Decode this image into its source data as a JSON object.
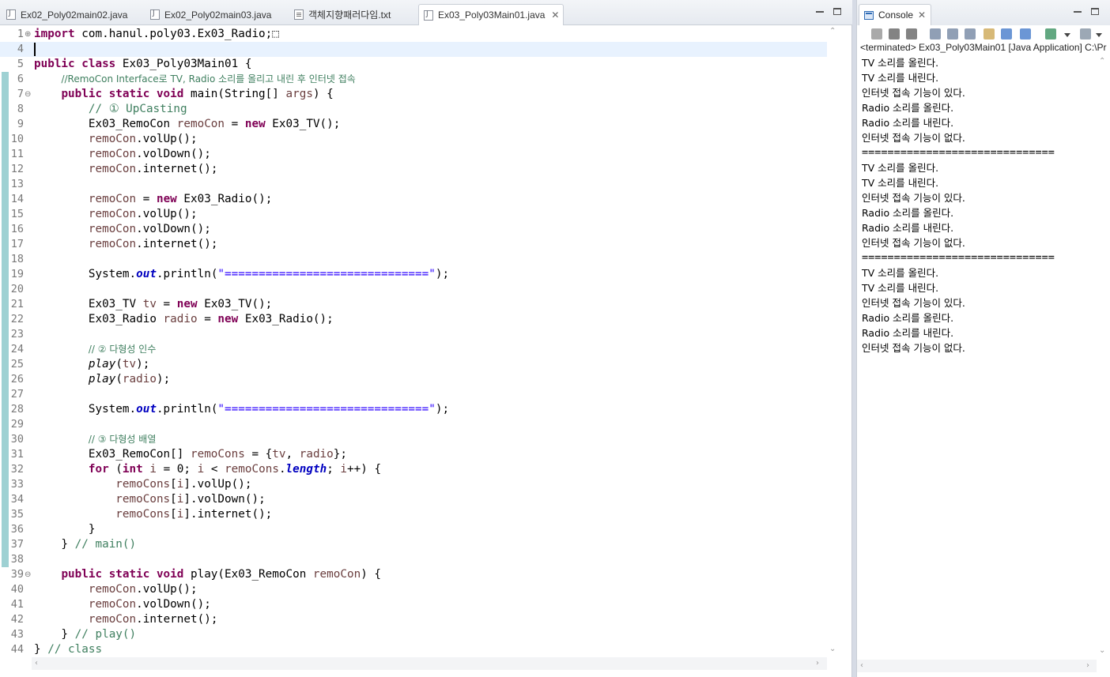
{
  "editor": {
    "tabs": [
      {
        "label": "Ex02_Poly02main02.java",
        "icon": "java-file-icon"
      },
      {
        "label": "Ex02_Poly02main03.java",
        "icon": "java-file-icon"
      },
      {
        "label": "객체지향패러다임.txt",
        "icon": "text-file-icon"
      },
      {
        "label": "Ex03_Poly03Main01.java",
        "icon": "java-file-icon",
        "active": true
      }
    ],
    "close_glyph": "✕",
    "lines": [
      {
        "n": "1",
        "fold": "⊕",
        "seg": [
          [
            "kw",
            "import"
          ],
          [
            "",
            "com.hanul.poly03.Ex03_Radio;"
          ],
          [
            "",
            "⬚"
          ]
        ]
      },
      {
        "n": "4",
        "cur": true,
        "seg": []
      },
      {
        "n": "5",
        "seg": [
          [
            "kw",
            "public class"
          ],
          [
            "",
            " Ex03_Poly03Main01 {"
          ]
        ]
      },
      {
        "n": "6",
        "seg": [
          [
            "",
            "    "
          ],
          [
            "cm",
            "//RemoCon Interface로 TV, Radio 소리를 올리고 내린 후 인터넷 접속"
          ]
        ]
      },
      {
        "n": "7",
        "fold": "⊖",
        "seg": [
          [
            "",
            "    "
          ],
          [
            "kw",
            "public static void"
          ],
          [
            "",
            " main(String[] "
          ],
          [
            "vr",
            "args"
          ],
          [
            "",
            ") {"
          ]
        ]
      },
      {
        "n": "8",
        "seg": [
          [
            "",
            "        "
          ],
          [
            "cm",
            "// ① UpCasting"
          ]
        ]
      },
      {
        "n": "9",
        "seg": [
          [
            "",
            "        Ex03_RemoCon "
          ],
          [
            "vr",
            "remoCon"
          ],
          [
            "",
            " = "
          ],
          [
            "kw",
            "new"
          ],
          [
            "",
            " Ex03_TV();"
          ]
        ]
      },
      {
        "n": "10",
        "seg": [
          [
            "",
            "        "
          ],
          [
            "vr",
            "remoCon"
          ],
          [
            "",
            ".volUp();"
          ]
        ]
      },
      {
        "n": "11",
        "seg": [
          [
            "",
            "        "
          ],
          [
            "vr",
            "remoCon"
          ],
          [
            "",
            ".volDown();"
          ]
        ]
      },
      {
        "n": "12",
        "seg": [
          [
            "",
            "        "
          ],
          [
            "vr",
            "remoCon"
          ],
          [
            "",
            ".internet();"
          ]
        ]
      },
      {
        "n": "13",
        "seg": []
      },
      {
        "n": "14",
        "seg": [
          [
            "",
            "        "
          ],
          [
            "vr",
            "remoCon"
          ],
          [
            "",
            " = "
          ],
          [
            "kw",
            "new"
          ],
          [
            "",
            " Ex03_Radio();"
          ]
        ]
      },
      {
        "n": "15",
        "seg": [
          [
            "",
            "        "
          ],
          [
            "vr",
            "remoCon"
          ],
          [
            "",
            ".volUp();"
          ]
        ]
      },
      {
        "n": "16",
        "seg": [
          [
            "",
            "        "
          ],
          [
            "vr",
            "remoCon"
          ],
          [
            "",
            ".volDown();"
          ]
        ]
      },
      {
        "n": "17",
        "seg": [
          [
            "",
            "        "
          ],
          [
            "vr",
            "remoCon"
          ],
          [
            "",
            ".internet();"
          ]
        ]
      },
      {
        "n": "18",
        "seg": []
      },
      {
        "n": "19",
        "seg": [
          [
            "",
            "        System."
          ],
          [
            "fld",
            "out"
          ],
          [
            "",
            ".println("
          ],
          [
            "st",
            "\"==============================\""
          ],
          [
            "",
            ");"
          ]
        ]
      },
      {
        "n": "20",
        "seg": []
      },
      {
        "n": "21",
        "seg": [
          [
            "",
            "        Ex03_TV "
          ],
          [
            "vr",
            "tv"
          ],
          [
            "",
            " = "
          ],
          [
            "kw",
            "new"
          ],
          [
            "",
            " Ex03_TV();"
          ]
        ]
      },
      {
        "n": "22",
        "seg": [
          [
            "",
            "        Ex03_Radio "
          ],
          [
            "vr",
            "radio"
          ],
          [
            "",
            " = "
          ],
          [
            "kw",
            "new"
          ],
          [
            "",
            " Ex03_Radio();"
          ]
        ]
      },
      {
        "n": "23",
        "seg": []
      },
      {
        "n": "24",
        "seg": [
          [
            "",
            "        "
          ],
          [
            "cm",
            "// ② 다형성 인수"
          ]
        ]
      },
      {
        "n": "25",
        "seg": [
          [
            "",
            "        "
          ],
          [
            "sm",
            "play"
          ],
          [
            "",
            "("
          ],
          [
            "vr",
            "tv"
          ],
          [
            "",
            ");"
          ]
        ]
      },
      {
        "n": "26",
        "seg": [
          [
            "",
            "        "
          ],
          [
            "sm",
            "play"
          ],
          [
            "",
            "("
          ],
          [
            "vr",
            "radio"
          ],
          [
            "",
            ");"
          ]
        ]
      },
      {
        "n": "27",
        "seg": []
      },
      {
        "n": "28",
        "seg": [
          [
            "",
            "        System."
          ],
          [
            "fld",
            "out"
          ],
          [
            "",
            ".println("
          ],
          [
            "st",
            "\"==============================\""
          ],
          [
            "",
            ");"
          ]
        ]
      },
      {
        "n": "29",
        "seg": []
      },
      {
        "n": "30",
        "seg": [
          [
            "",
            "        "
          ],
          [
            "cm",
            "// ③ 다형성 배열"
          ]
        ]
      },
      {
        "n": "31",
        "seg": [
          [
            "",
            "        Ex03_RemoCon[] "
          ],
          [
            "vr",
            "remoCons"
          ],
          [
            "",
            " = {"
          ],
          [
            "vr",
            "tv"
          ],
          [
            "",
            ", "
          ],
          [
            "vr",
            "radio"
          ],
          [
            "",
            "};"
          ]
        ]
      },
      {
        "n": "32",
        "seg": [
          [
            "",
            "        "
          ],
          [
            "kw",
            "for"
          ],
          [
            "",
            " ("
          ],
          [
            "kw",
            "int"
          ],
          [
            "",
            " "
          ],
          [
            "vr",
            "i"
          ],
          [
            "",
            " = 0; "
          ],
          [
            "vr",
            "i"
          ],
          [
            "",
            " < "
          ],
          [
            "vr",
            "remoCons"
          ],
          [
            "",
            "."
          ],
          [
            "fld",
            "length"
          ],
          [
            "",
            "; "
          ],
          [
            "vr",
            "i"
          ],
          [
            "",
            "++) {"
          ]
        ]
      },
      {
        "n": "33",
        "seg": [
          [
            "",
            "            "
          ],
          [
            "vr",
            "remoCons"
          ],
          [
            "",
            "["
          ],
          [
            "vr",
            "i"
          ],
          [
            "",
            "].volUp();"
          ]
        ]
      },
      {
        "n": "34",
        "seg": [
          [
            "",
            "            "
          ],
          [
            "vr",
            "remoCons"
          ],
          [
            "",
            "["
          ],
          [
            "vr",
            "i"
          ],
          [
            "",
            "].volDown();"
          ]
        ]
      },
      {
        "n": "35",
        "seg": [
          [
            "",
            "            "
          ],
          [
            "vr",
            "remoCons"
          ],
          [
            "",
            "["
          ],
          [
            "vr",
            "i"
          ],
          [
            "",
            "].internet();"
          ]
        ]
      },
      {
        "n": "36",
        "seg": [
          [
            "",
            "        }"
          ]
        ]
      },
      {
        "n": "37",
        "seg": [
          [
            "",
            "    } "
          ],
          [
            "cm",
            "// main()"
          ]
        ]
      },
      {
        "n": "38",
        "seg": []
      },
      {
        "n": "39",
        "fold": "⊖",
        "seg": [
          [
            "",
            "    "
          ],
          [
            "kw",
            "public static void"
          ],
          [
            "",
            " play(Ex03_RemoCon "
          ],
          [
            "vr",
            "remoCon"
          ],
          [
            "",
            ") {"
          ]
        ]
      },
      {
        "n": "40",
        "seg": [
          [
            "",
            "        "
          ],
          [
            "vr",
            "remoCon"
          ],
          [
            "",
            ".volUp();"
          ]
        ]
      },
      {
        "n": "41",
        "seg": [
          [
            "",
            "        "
          ],
          [
            "vr",
            "remoCon"
          ],
          [
            "",
            ".volDown();"
          ]
        ]
      },
      {
        "n": "42",
        "seg": [
          [
            "",
            "        "
          ],
          [
            "vr",
            "remoCon"
          ],
          [
            "",
            ".internet();"
          ]
        ]
      },
      {
        "n": "43",
        "seg": [
          [
            "",
            "    } "
          ],
          [
            "cm",
            "// play()"
          ]
        ]
      },
      {
        "n": "44",
        "seg": [
          [
            "",
            "} "
          ],
          [
            "cm",
            "// class"
          ]
        ]
      }
    ]
  },
  "console": {
    "title": "Console",
    "close_glyph": "✕",
    "status": "<terminated> Ex03_Poly03Main01 [Java Application] C:\\Pr",
    "output": [
      "TV 소리를 올린다.",
      "TV 소리를 내린다.",
      "인터넷 접속 기능이 있다.",
      "Radio 소리를 올린다.",
      "Radio 소리를 내린다.",
      "인터넷 접속 기능이 없다.",
      "==============================",
      "TV 소리를 올린다.",
      "TV 소리를 내린다.",
      "인터넷 접속 기능이 있다.",
      "Radio 소리를 올린다.",
      "Radio 소리를 내린다.",
      "인터넷 접속 기능이 없다.",
      "==============================",
      "TV 소리를 올린다.",
      "TV 소리를 내린다.",
      "인터넷 접속 기능이 있다.",
      "Radio 소리를 올린다.",
      "Radio 소리를 내린다.",
      "인터넷 접속 기능이 없다."
    ],
    "toolbar_icons": [
      "terminate-icon",
      "remove-launch-icon",
      "remove-all-icon",
      "clear-console-icon",
      "scroll-lock-icon",
      "word-wrap-icon",
      "show-stdout-icon",
      "show-stderr-icon",
      "pin-console-icon",
      "display-console-icon",
      "dropdown-icon",
      "open-console-icon",
      "dropdown-icon"
    ]
  },
  "colors": {
    "keyword": "#7f0055",
    "comment": "#3f7f5f",
    "string": "#2a00ff",
    "field": "#0000c0",
    "variable": "#6a3e3e",
    "current_line": "#e8f2fe"
  }
}
